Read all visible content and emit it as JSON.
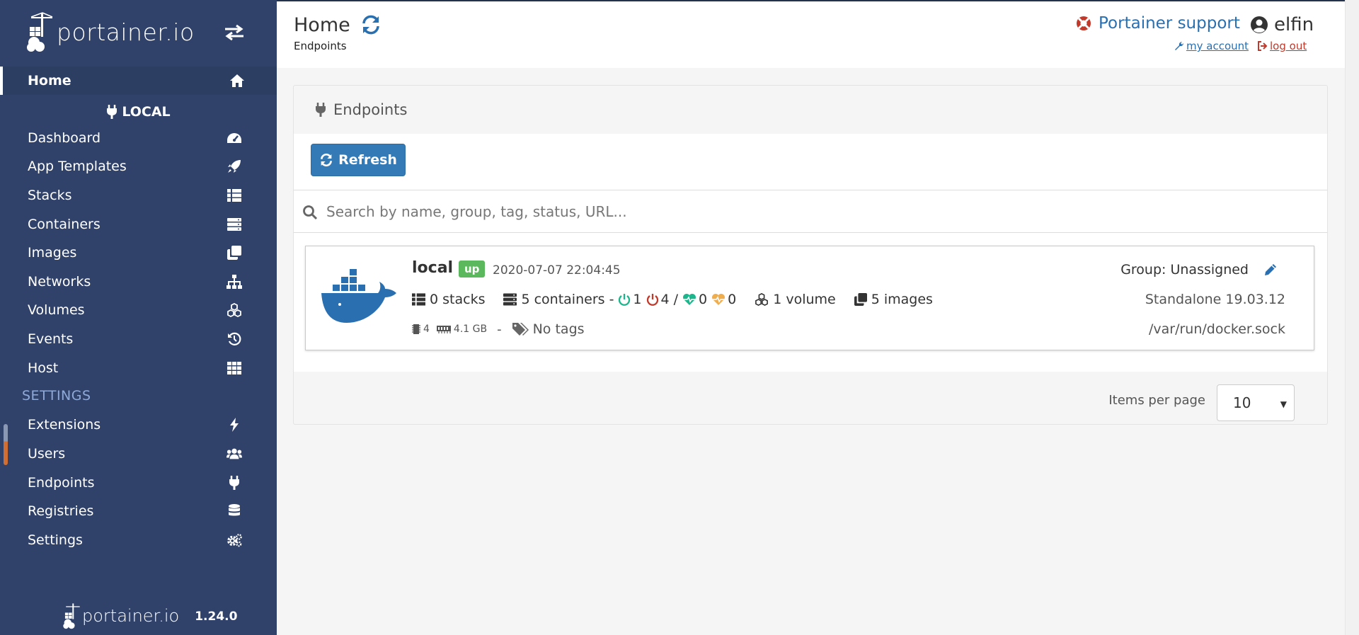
{
  "brand": {
    "name": "portainer.io"
  },
  "sidebar": {
    "home": "Home",
    "endpoint_name": "LOCAL",
    "items": [
      {
        "label": "Dashboard",
        "icon": "tachometer-icon"
      },
      {
        "label": "App Templates",
        "icon": "rocket-icon"
      },
      {
        "label": "Stacks",
        "icon": "th-list-icon"
      },
      {
        "label": "Containers",
        "icon": "server-icon"
      },
      {
        "label": "Images",
        "icon": "clone-icon"
      },
      {
        "label": "Networks",
        "icon": "sitemap-icon"
      },
      {
        "label": "Volumes",
        "icon": "cubes-icon"
      },
      {
        "label": "Events",
        "icon": "history-icon"
      },
      {
        "label": "Host",
        "icon": "th-icon"
      }
    ],
    "settings_heading": "SETTINGS",
    "settings_items": [
      {
        "label": "Extensions",
        "icon": "bolt-icon"
      },
      {
        "label": "Users",
        "icon": "users-icon"
      },
      {
        "label": "Endpoints",
        "icon": "plug-icon"
      },
      {
        "label": "Registries",
        "icon": "database-icon"
      },
      {
        "label": "Settings",
        "icon": "cogs-icon"
      }
    ],
    "footer": {
      "brand": "portainer.io",
      "version": "1.24.0"
    }
  },
  "header": {
    "title": "Home",
    "breadcrumb": "Endpoints",
    "support": "Portainer support",
    "username": "elfin",
    "my_account": "my account",
    "log_out": "log out"
  },
  "panel": {
    "title": "Endpoints",
    "refresh_label": "Refresh",
    "search_placeholder": "Search by name, group, tag, status, URL..."
  },
  "endpoint": {
    "name": "local",
    "status": "up",
    "timestamp": "2020-07-07 22:04:45",
    "group": "Group: Unassigned",
    "stacks": "0 stacks",
    "containers": "5 containers -",
    "running": "1",
    "stopped": "4",
    "separator": "/",
    "healthy": "0",
    "unhealthy": "0",
    "volumes": "1 volume",
    "images": "5 images",
    "version": "Standalone 19.03.12",
    "cpu": "4",
    "memory": "4.1 GB",
    "dash": "-",
    "tags": "No tags",
    "url": "/var/run/docker.sock"
  },
  "pagination": {
    "label": "Items per page",
    "value": "10"
  },
  "colors": {
    "sidebar": "#30426a",
    "primary": "#337ab7",
    "up": "#5cb85c",
    "support": "#2a6fb0",
    "logout": "#c0392b"
  }
}
